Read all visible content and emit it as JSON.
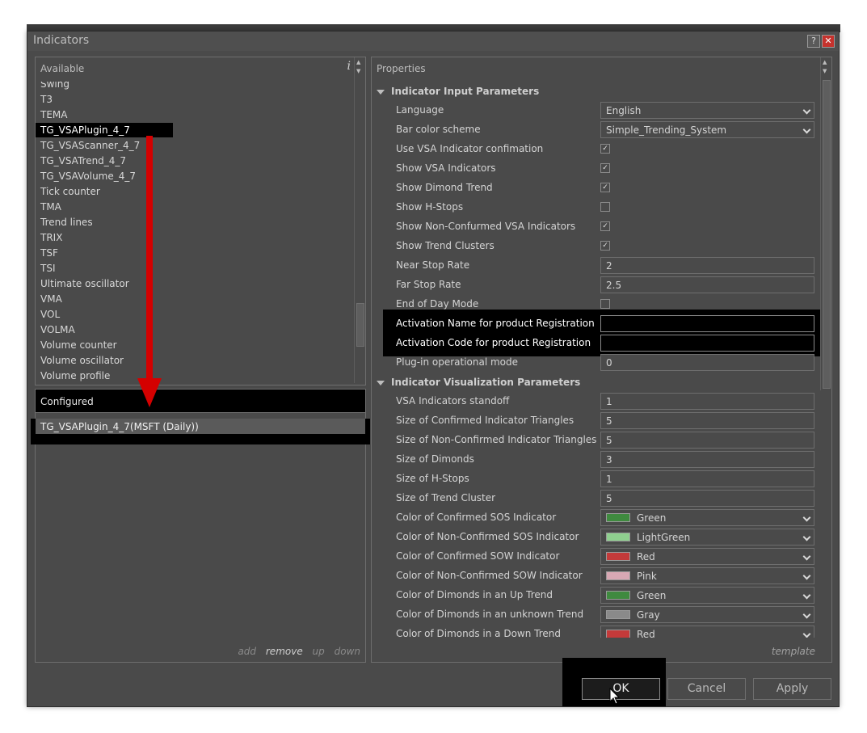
{
  "window": {
    "title": "Indicators",
    "help_label": "?",
    "close_label": "✕"
  },
  "available": {
    "header": "Available",
    "info_label": "i",
    "items": [
      "Swing",
      "T3",
      "TEMA",
      "TG_VSAPlugin_4_7",
      "TG_VSAScanner_4_7",
      "TG_VSATrend_4_7",
      "TG_VSAVolume_4_7",
      "Tick counter",
      "TMA",
      "Trend lines",
      "TRIX",
      "TSF",
      "TSI",
      "Ultimate oscillator",
      "VMA",
      "VOL",
      "VOLMA",
      "Volume counter",
      "Volume oscillator",
      "Volume profile"
    ],
    "selected_index": 3
  },
  "configured": {
    "header": "Configured",
    "items": [
      "TG_VSAPlugin_4_7(MSFT (Daily))"
    ],
    "links": {
      "add": "add",
      "remove": "remove",
      "up": "up",
      "down": "down"
    }
  },
  "properties": {
    "header": "Properties",
    "template_label": "template",
    "input_section": "Indicator Input Parameters",
    "input_rows": [
      {
        "label": "Language",
        "kind": "select",
        "value": "English"
      },
      {
        "label": "Bar color scheme",
        "kind": "select",
        "value": "Simple_Trending_System"
      },
      {
        "label": "Use VSA Indicator confimation",
        "kind": "check",
        "value": "✓"
      },
      {
        "label": "Show VSA Indicators",
        "kind": "check",
        "value": "✓"
      },
      {
        "label": "Show Dimond Trend",
        "kind": "check",
        "value": "✓"
      },
      {
        "label": "Show H-Stops",
        "kind": "check",
        "value": ""
      },
      {
        "label": "Show Non-Confurmed VSA Indicators",
        "kind": "check",
        "value": "✓"
      },
      {
        "label": "Show Trend Clusters",
        "kind": "check",
        "value": "✓"
      },
      {
        "label": "Near Stop Rate",
        "kind": "text",
        "value": "2"
      },
      {
        "label": "Far Stop Rate",
        "kind": "text",
        "value": "2.5"
      },
      {
        "label": "End of Day Mode",
        "kind": "check",
        "value": ""
      }
    ],
    "activation_name_label": "Activation Name for product Registration",
    "activation_name_value": "",
    "activation_code_label": "Activation Code for product Registration",
    "activation_code_value": "",
    "plugin_mode_label": "Plug-in operational mode",
    "plugin_mode_value": "0",
    "vis_section": "Indicator Visualization Parameters",
    "vis_rows": [
      {
        "label": "VSA Indicators standoff",
        "value": "1"
      },
      {
        "label": "Size of Confirmed Indicator Triangles",
        "value": "5"
      },
      {
        "label": "Size of Non-Confirmed Indicator Triangles",
        "value": "5"
      },
      {
        "label": "Size of Dimonds",
        "value": "3"
      },
      {
        "label": "Size of H-Stops",
        "value": "1"
      },
      {
        "label": "Size of Trend Cluster",
        "value": "5"
      }
    ],
    "color_rows": [
      {
        "label": "Color of Confirmed SOS Indicator",
        "color_name": "Green",
        "color": "#3f8a3f"
      },
      {
        "label": "Color of Non-Confirmed SOS Indicator",
        "color_name": "LightGreen",
        "color": "#8fcf8f"
      },
      {
        "label": "Color of Confirmed SOW Indicator",
        "color_name": "Red",
        "color": "#c43a3a"
      },
      {
        "label": "Color of Non-Confirmed SOW Indicator",
        "color_name": "Pink",
        "color": "#d8a8b4"
      },
      {
        "label": "Color of Dimonds in an Up Trend",
        "color_name": "Green",
        "color": "#3f8a3f"
      },
      {
        "label": "Color of Dimonds in an unknown Trend",
        "color_name": "Gray",
        "color": "#8a8a8a"
      },
      {
        "label": "Color of Dimonds in a Down Trend",
        "color_name": "Red",
        "color": "#c43a3a"
      }
    ]
  },
  "buttons": {
    "ok": "OK",
    "cancel": "Cancel",
    "apply": "Apply"
  },
  "annotation": {
    "arrow_color": "#d40000"
  }
}
